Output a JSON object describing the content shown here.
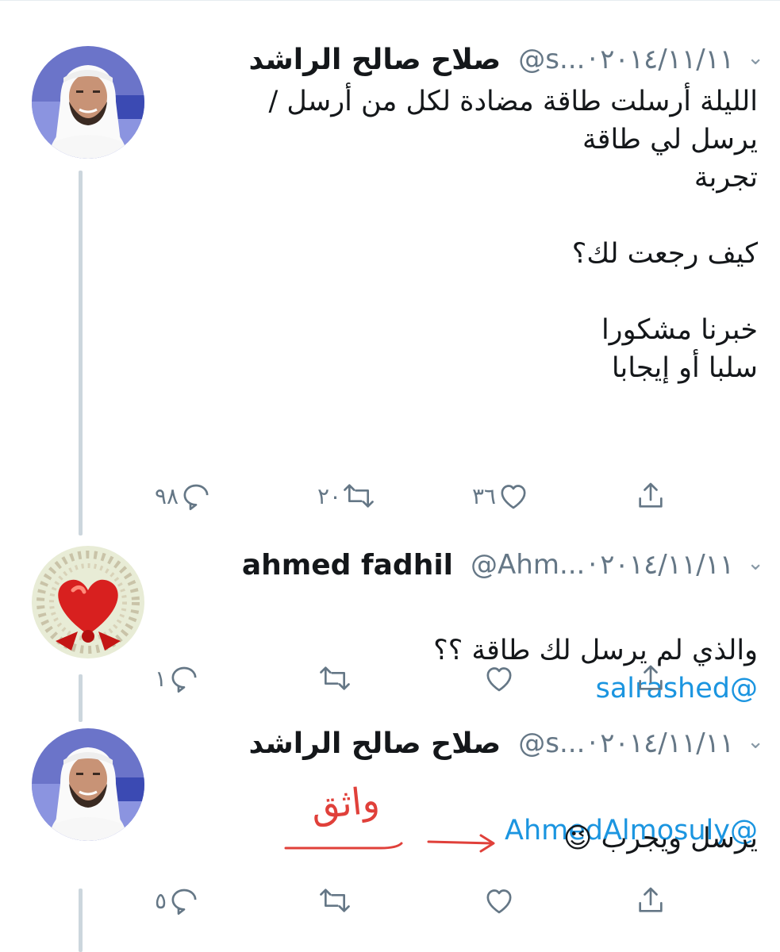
{
  "tweets": [
    {
      "display_name": "صلاح صالح الراشد",
      "handle": "@s...",
      "dot": "·",
      "date": "٢٠١٤/١١/١١",
      "chevron": "⌄",
      "mention": "",
      "text": "الليلة أرسلت طاقة مضادة لكل من أرسل /\nيرسل لي طاقة\nتجربة\n\nكيف رجعت لك؟\n\nخبرنا مشكورا\nسلبا أو إيجابا",
      "reply_count": "٩٨",
      "retweet_count": "٢٠",
      "like_count": "٣٦"
    },
    {
      "display_name": "ahmed fadhil",
      "handle": "@Ahm...",
      "dot": "·",
      "date": "٢٠١٤/١١/١١",
      "chevron": "⌄",
      "mention": "@salrashed",
      "text": "والذي لم يرسل لك طاقة ؟؟",
      "reply_count": "١",
      "retweet_count": "",
      "like_count": ""
    },
    {
      "display_name": "صلاح صالح الراشد",
      "handle": "@s...",
      "dot": "·",
      "date": "٢٠١٤/١١/١١",
      "chevron": "⌄",
      "mention": "@AhmedAlmosuly",
      "text": "يرسل ويجرب 😉",
      "reply_count": "٥",
      "retweet_count": "",
      "like_count": ""
    }
  ],
  "annotation": {
    "handwritten_text": "واثق",
    "color": "#e0403a"
  },
  "colors": {
    "link": "#1b95e0",
    "meta": "#657786",
    "rail": "#ccd6dd"
  },
  "icons": [
    "reply-icon",
    "retweet-icon",
    "like-icon",
    "share-icon",
    "chevron-down-icon",
    "wink-emoji-icon",
    "heart-avatar"
  ]
}
